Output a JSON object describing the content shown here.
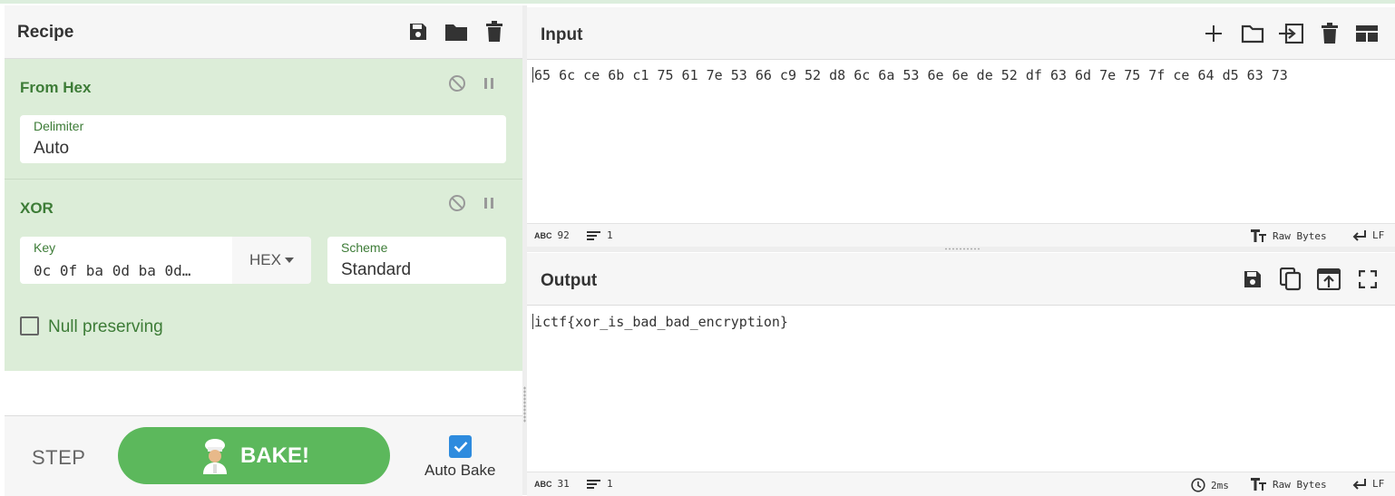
{
  "recipe": {
    "title": "Recipe",
    "operations": [
      {
        "name": "From Hex",
        "delimiter_label": "Delimiter",
        "delimiter_value": "Auto"
      },
      {
        "name": "XOR",
        "key_label": "Key",
        "key_value": "0c 0f ba 0d ba 0d…",
        "key_format": "HEX",
        "scheme_label": "Scheme",
        "scheme_value": "Standard",
        "null_preserving_label": "Null preserving",
        "null_preserving_checked": false
      }
    ],
    "controls": {
      "step_label": "STEP",
      "bake_label": "BAKE!",
      "auto_bake_label": "Auto Bake",
      "auto_bake_checked": true
    }
  },
  "input": {
    "title": "Input",
    "text": "65 6c ce 6b c1 75 61 7e 53 66 c9 52 d8 6c 6a 53 6e 6e de 52 df 63 6d 7e 75 7f ce 64 d5 63 73",
    "status": {
      "length": "92",
      "lines": "1",
      "encoding": "Raw Bytes",
      "eol": "LF"
    }
  },
  "output": {
    "title": "Output",
    "text": "ictf{xor_is_bad_bad_encryption}",
    "status": {
      "length": "31",
      "lines": "1",
      "time": "2ms",
      "encoding": "Raw Bytes",
      "eol": "LF"
    }
  },
  "colors": {
    "operation_bg": "#dcedd8",
    "operation_text": "#3d7c37",
    "bake_button": "#5cb85c",
    "checkbox_checked": "#2e8bde"
  },
  "icons": {
    "recipe_header": [
      "save-icon",
      "folder-icon",
      "trash-icon"
    ],
    "input_header": [
      "plus-icon",
      "folder-icon",
      "insert-icon",
      "trash-icon",
      "layout-icon"
    ],
    "output_header": [
      "save-icon",
      "copy-icon",
      "replace-input-icon",
      "maximize-icon"
    ],
    "operation": [
      "disable-icon",
      "pause-icon"
    ]
  }
}
